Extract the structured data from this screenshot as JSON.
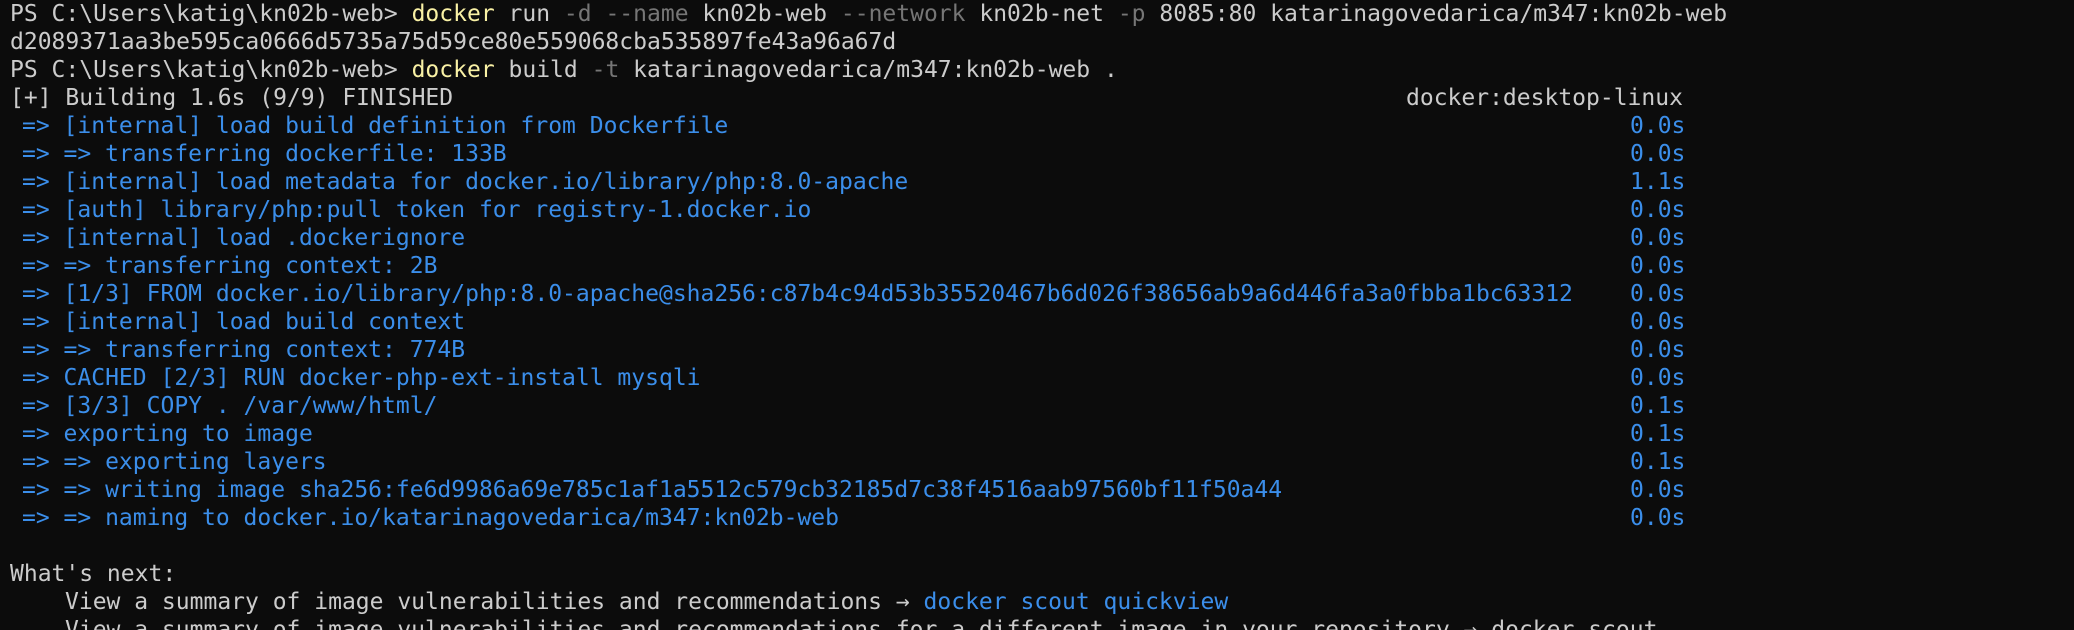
{
  "terminal": {
    "line1": {
      "prompt": "PS C:\\Users\\katig\\kn02b-web> ",
      "cmd": "docker",
      "arg1": " run ",
      "flag1": "-d --name",
      "arg2": " kn02b-web ",
      "flag2": "--network",
      "arg3": " kn02b-net ",
      "flag3": "-p",
      "arg4": " 8085:80 katarinagovedarica/m347:kn02b-web"
    },
    "line2": "d2089371aa3be595ca0666d5735a75d59ce80e559068cba535897fe43a96a67d",
    "line3": {
      "prompt": "PS C:\\Users\\katig\\kn02b-web> ",
      "cmd": "docker",
      "arg1": " build ",
      "flag1": "-t",
      "arg2": " katarinagovedarica/m347:kn02b-web ."
    },
    "build_header": {
      "text": "[+] Building 1.6s (9/9) FINISHED",
      "platform": "docker:desktop-linux"
    },
    "steps": [
      {
        "text": "=> [internal] load build definition from Dockerfile",
        "time": "0.0s"
      },
      {
        "text": "=> => transferring dockerfile: 133B",
        "time": "0.0s"
      },
      {
        "text": "=> [internal] load metadata for docker.io/library/php:8.0-apache",
        "time": "1.1s"
      },
      {
        "text": "=> [auth] library/php:pull token for registry-1.docker.io",
        "time": "0.0s"
      },
      {
        "text": "=> [internal] load .dockerignore",
        "time": "0.0s"
      },
      {
        "text": "=> => transferring context: 2B",
        "time": "0.0s"
      },
      {
        "text": "=> [1/3] FROM docker.io/library/php:8.0-apache@sha256:c87b4c94d53b35520467b6d026f38656ab9a6d446fa3a0fbba1bc63312",
        "time": "0.0s"
      },
      {
        "text": "=> [internal] load build context",
        "time": "0.0s"
      },
      {
        "text": "=> => transferring context: 774B",
        "time": "0.0s"
      },
      {
        "text": "=> CACHED [2/3] RUN docker-php-ext-install mysqli",
        "time": "0.0s"
      },
      {
        "text": "=> [3/3] COPY . /var/www/html/",
        "time": "0.1s"
      },
      {
        "text": "=> exporting to image",
        "time": "0.1s"
      },
      {
        "text": "=> => exporting layers",
        "time": "0.1s"
      },
      {
        "text": "=> => writing image sha256:fe6d9986a69e785c1af1a5512c579cb32185d7c38f4516aab97560bf11f50a44",
        "time": "0.0s"
      },
      {
        "text": "=> => naming to docker.io/katarinagovedarica/m347:kn02b-web",
        "time": "0.0s"
      }
    ],
    "whats_next": "What's next:",
    "summary": {
      "text": "View a summary of image vulnerabilities and recommendations → ",
      "link": "docker scout quickview"
    },
    "partial_line": "View a summary of image vulnerabilities and recommendations for a different image in your repository → docker scout"
  },
  "colors": {
    "background": "#0c0c0c",
    "foreground": "#cccccc",
    "command": "#f9f1a5",
    "flag": "#767676",
    "blue": "#3b8eea"
  }
}
